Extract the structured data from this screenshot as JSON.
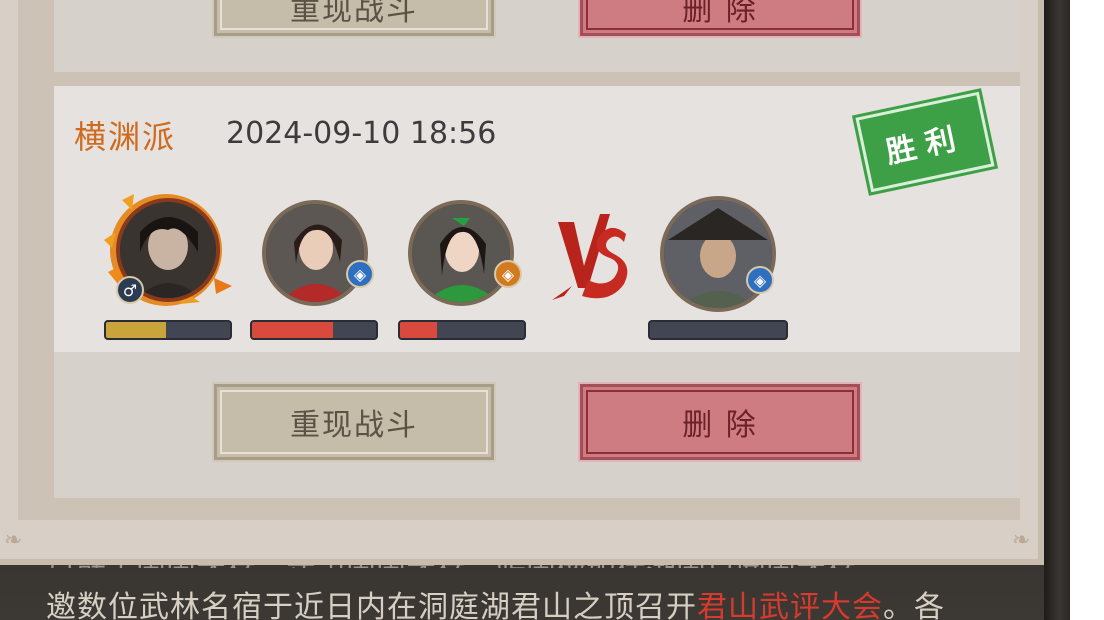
{
  "prev_card": {
    "replay_label": "重现战斗",
    "delete_label": "删 除"
  },
  "battle": {
    "sect": "横渊派",
    "timestamp": "2024-09-10 18:56",
    "result": "胜利",
    "vs": "VS",
    "team": [
      {
        "name": "hero-1",
        "badge_icon": "male-symbol-icon",
        "badge_glyph": "♂",
        "hp": 0.48,
        "hp_color": "#c9a43a"
      },
      {
        "name": "hero-2",
        "badge_icon": "blue-element-icon",
        "badge_glyph": "◈",
        "hp": 0.65,
        "hp_color": "#d84a3e"
      },
      {
        "name": "hero-3",
        "badge_icon": "orange-element-icon",
        "badge_glyph": "◈",
        "hp": 0.3,
        "hp_color": "#d84a3e"
      }
    ],
    "enemy": {
      "name": "enemy-1",
      "badge_icon": "blue-element-icon",
      "badge_glyph": "◈",
      "hp": 0.0
    },
    "replay_label": "重现战斗",
    "delete_label": "删 除"
  },
  "story": {
    "line_before": "邀数位武林名宿于近日内在洞庭湖君山之顶召开",
    "highlight": "君山武评大会",
    "line_after": "。各"
  }
}
